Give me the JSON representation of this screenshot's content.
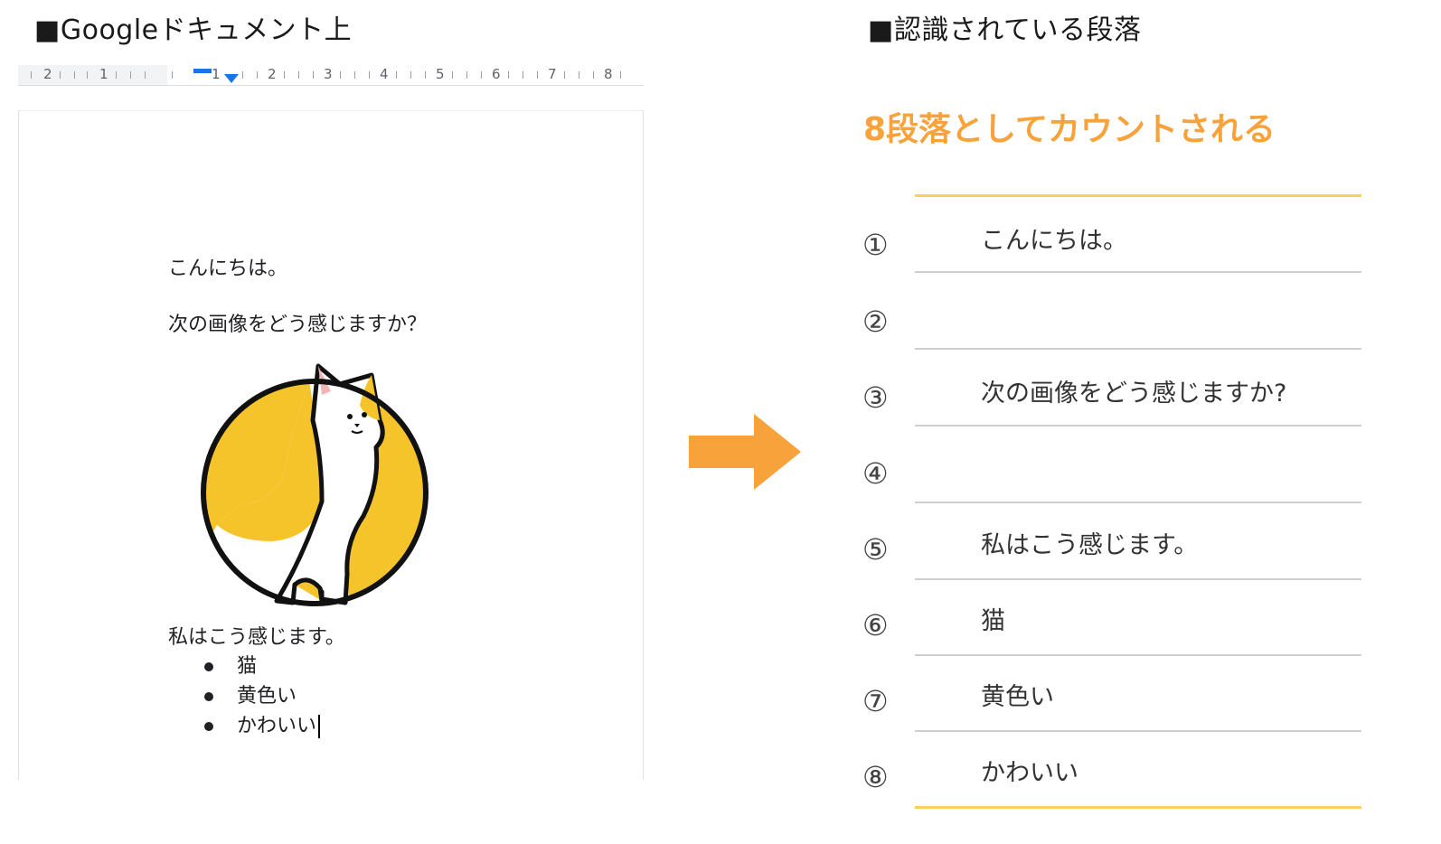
{
  "left_heading": "■Googleドキュメント上",
  "right_heading": "■認識されている段落",
  "ruler": {
    "numbers": [
      "2",
      "1",
      "1",
      "2",
      "3",
      "4",
      "5",
      "6",
      "7",
      "8"
    ]
  },
  "document": {
    "paragraph_1": "こんにちは。",
    "paragraph_3": "次の画像をどう感じますか？",
    "paragraph_5": "私はこう感じます。",
    "bullets": [
      "猫",
      "黄色い",
      "かわいい"
    ]
  },
  "result": {
    "title": "8段落としてカウントされる",
    "rows": [
      {
        "num": "①",
        "text": "こんにちは。"
      },
      {
        "num": "②",
        "text": ""
      },
      {
        "num": "③",
        "text": "次の画像をどう感じますか?"
      },
      {
        "num": "④",
        "text": ""
      },
      {
        "num": "⑤",
        "text": "私はこう感じます。"
      },
      {
        "num": "⑥",
        "text": "猫"
      },
      {
        "num": "⑦",
        "text": "黄色い"
      },
      {
        "num": "⑧",
        "text": "かわいい"
      }
    ]
  },
  "colors": {
    "accent_orange": "#f7a23b",
    "gold_line": "#fbcf5a",
    "cat_yellow": "#f5c42b",
    "ruler_blue": "#1a73e8"
  }
}
